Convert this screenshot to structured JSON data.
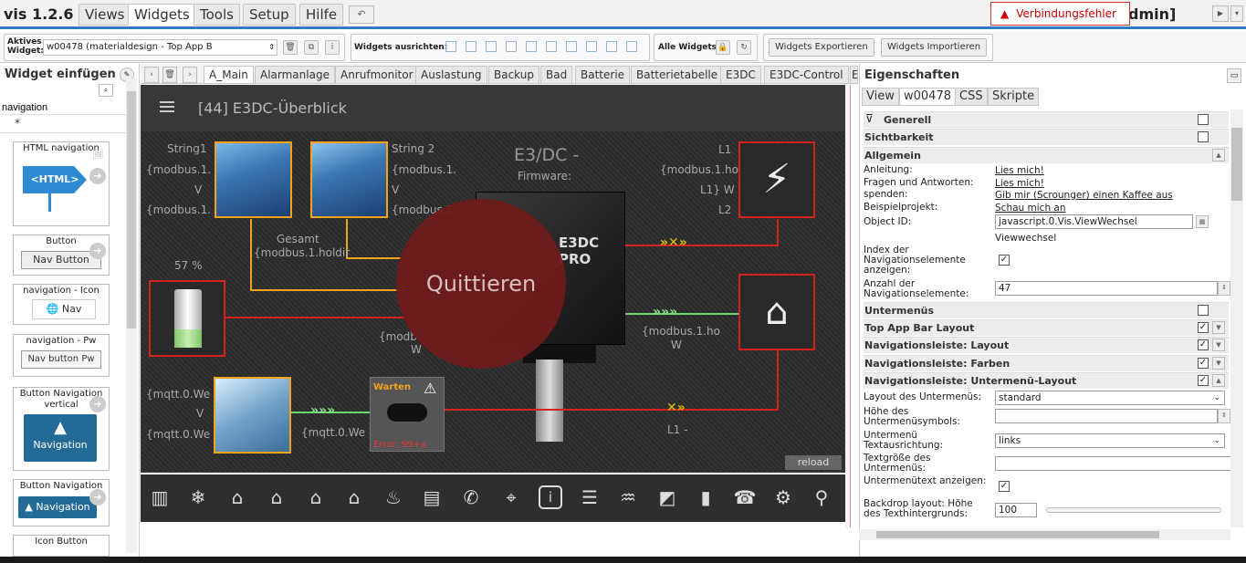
{
  "app": {
    "version": "vis 1.2.6",
    "user": "dmin]"
  },
  "menu": [
    "Views",
    "Widgets",
    "Tools",
    "Setup",
    "Hilfe"
  ],
  "error": {
    "label": "Verbindungsfehler"
  },
  "toolbar": {
    "active_widget_label": "Aktives Widget:",
    "active_widget_value": "w00478 (materialdesign - Top App B",
    "align_label": "Widgets ausrichten:",
    "all_label": "Alle Widgets:",
    "export_label": "Widgets Exportieren",
    "import_label": "Widgets Importieren"
  },
  "left": {
    "title": "Widget einfügen",
    "search_value": "navigation",
    "set_value": "*",
    "cards": [
      {
        "title": "HTML navigation",
        "preview": "<HTML>"
      },
      {
        "title": "Button",
        "preview": "Nav Button"
      },
      {
        "title": "navigation - Icon",
        "preview": "Nav"
      },
      {
        "title": "navigation - Pw",
        "preview": "Nav button Pw"
      },
      {
        "title": "Button Navigation vertical",
        "preview": "Navigation"
      },
      {
        "title": "Button Navigation",
        "preview": "Navigation"
      },
      {
        "title": "Icon Button",
        "preview": ""
      }
    ]
  },
  "view_tabs": [
    "A_Main",
    "Alarmanlage",
    "Anrufmonitor",
    "Auslastung",
    "Backup",
    "Bad",
    "Batterie",
    "Batterietabelle",
    "E3DC",
    "E3DC-Control",
    "E"
  ],
  "canvas": {
    "title": "[44] E3DC-Überblick",
    "string1": "String1",
    "string2": "String 2",
    "mod1": "{modbus.1.",
    "v": "V",
    "mod1b": "{modbus.1.",
    "s2mod": "{modbus.1.",
    "s2v": "V",
    "s2mod2": "{modbus.1.",
    "e3dc_title": "E3/DC -",
    "firmware": "Firmware:",
    "l1": "L1",
    "l1mod": "{modbus.1.ho",
    "l1w": "L1} W",
    "l2": "L2",
    "gesamt": "Gesamt",
    "gesamt_mod": "{modbus.1.holdir",
    "battery_pct": "57 %",
    "bat_mod": "{modb",
    "bat_w": "W",
    "house_mod": "{modbus.1.ho",
    "house_w": "W",
    "mqtt1": "{mqtt.0.We",
    "mqtt_v": "V",
    "mqtt2": "{mqtt.0.We",
    "mqtt3": "{mqtt.0.We",
    "wr_status": "Warten",
    "wr_error": "Error: 99+x",
    "l1_bottom": "L1 -",
    "quit": "Quittieren",
    "reload": "reload",
    "brand": "E3DC PRO"
  },
  "bottom_icons": [
    "radiator-icon",
    "snowflake-icon",
    "house-kg-icon",
    "house-eg-icon",
    "house-og-icon",
    "house-info-icon",
    "bath-icon",
    "newspaper-icon",
    "phone-signal-icon",
    "camera-icon",
    "info-icon",
    "document-icon",
    "solar-p-icon",
    "solar-panel-icon",
    "battery-icon",
    "telephone-icon",
    "gears-icon",
    "antenna-icon"
  ],
  "right": {
    "title": "Eigenschaften",
    "tabs": [
      "View",
      "w00478",
      "CSS",
      "Skripte"
    ],
    "sections": {
      "generell": "Generell",
      "sichtbarkeit": "Sichtbarkeit",
      "allgemein": "Allgemein",
      "untermenus": "Untermenüs",
      "top_app_bar": "Top App Bar Layout",
      "nav_layout": "Navigationsleiste: Layout",
      "nav_farben": "Navigationsleiste: Farben",
      "nav_unter": "Navigationsleiste: Untermenü-Layout"
    },
    "props": {
      "anleitung_l": "Anleitung:",
      "anleitung_v": "Lies mich!",
      "faq_l": "Fragen und Antworten:",
      "faq_v": "Lies mich!",
      "spenden_l": "spenden:",
      "spenden_v": "Gib mir (Scrounger) einen Kaffee aus",
      "beispiel_l": "Beispielprojekt:",
      "beispiel_v": "Schau mich an",
      "oid_l": "Object ID:",
      "oid_v": "javascript.0.Vis.ViewWechsel",
      "oid_name": "Viewwechsel",
      "index_l": "Index der Navigationselemente anzeigen:",
      "anzahl_l": "Anzahl der Navigationselemente:",
      "anzahl_v": "47",
      "layout_l": "Layout des Untermenüs:",
      "layout_v": "standard",
      "hoehe_l": "Höhe des Untermenüsymbols:",
      "ausr_l": "Untermenü Textausrichtung:",
      "ausr_v": "links",
      "groesse_l": "Textgröße des Untermenüs:",
      "untertext_l": "Untermenütext anzeigen:",
      "backdrop_l": "Backdrop layout: Höhe des Texthintergrunds:",
      "backdrop_v": "100"
    }
  },
  "colors": {
    "accent": "#2d7cc4",
    "error": "#cc0000",
    "canvas_bg": "#2b2b2b",
    "device_orange": "#f2a31a",
    "device_red": "#d72020"
  }
}
